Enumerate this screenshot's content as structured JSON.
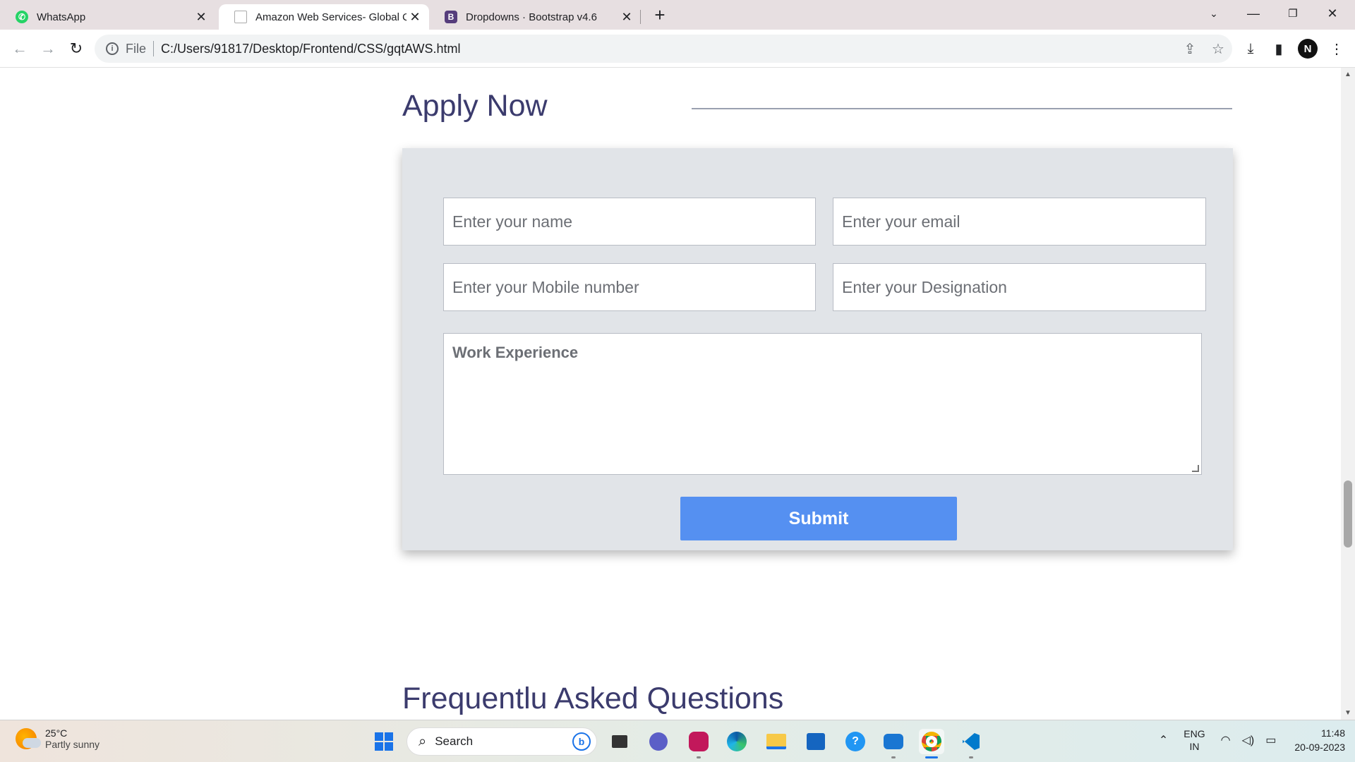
{
  "browser": {
    "tabs": [
      {
        "title": "WhatsApp",
        "active": false,
        "favicon": "whatsapp-icon"
      },
      {
        "title": "Amazon Web Services- Global Q",
        "active": true,
        "favicon": "page-icon"
      },
      {
        "title": "Dropdowns · Bootstrap v4.6",
        "active": false,
        "favicon": "bootstrap-icon"
      }
    ],
    "new_tab_glyph": "+",
    "close_glyph": "✕",
    "address": {
      "scheme_label": "File",
      "url": "C:/Users/91817/Desktop/Frontend/CSS/gqtAWS.html"
    },
    "profile_initial": "N"
  },
  "page": {
    "apply_title": "Apply Now",
    "form": {
      "name_placeholder": "Enter your name",
      "email_placeholder": "Enter your email",
      "mobile_placeholder": "Enter your Mobile number",
      "designation_placeholder": "Enter your Designation",
      "experience_placeholder": "Work Experience",
      "submit_label": "Submit"
    },
    "faq_title": "Frequentlu Asked Questions"
  },
  "taskbar": {
    "weather": {
      "temp": "25°C",
      "condition": "Partly sunny"
    },
    "search_label": "Search",
    "lang": {
      "line1": "ENG",
      "line2": "IN"
    },
    "clock": {
      "time": "11:48",
      "date": "20-09-2023"
    }
  },
  "colors": {
    "heading": "#3b3b6d",
    "submit_bg": "#5590f1",
    "card_bg": "#e1e4e8",
    "tabstrip_bg": "#e7dfe1"
  }
}
